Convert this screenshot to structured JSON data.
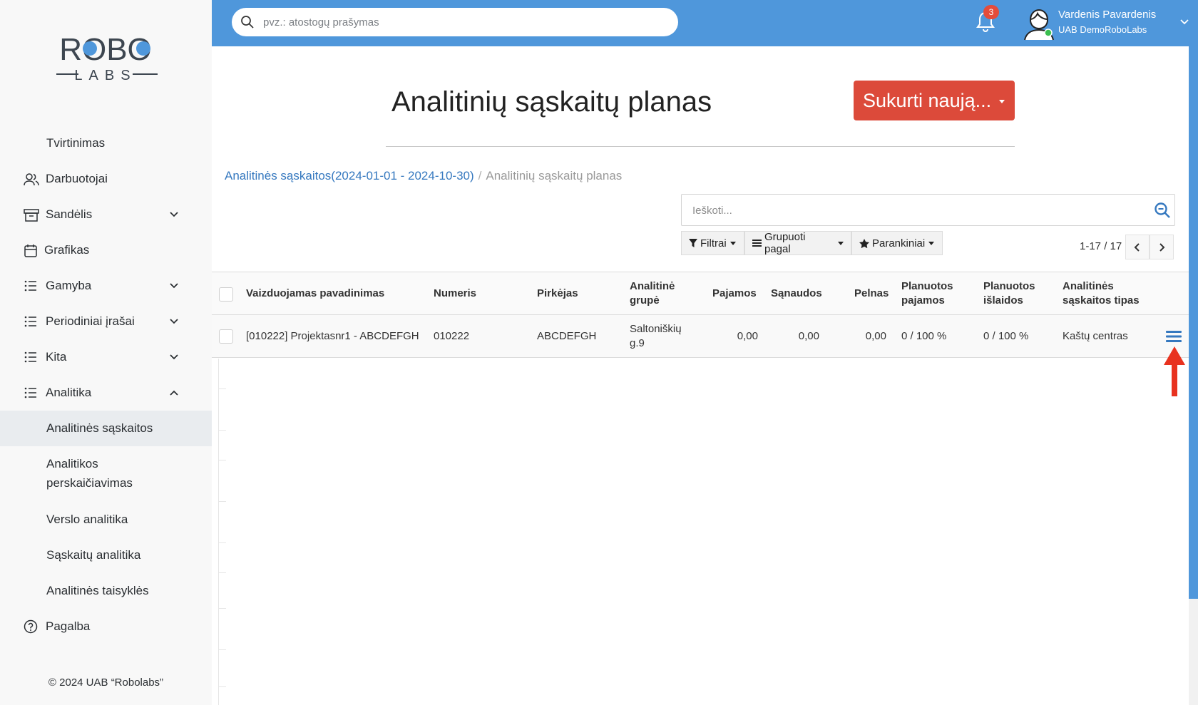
{
  "brand": {
    "logo_top": "ROBO",
    "logo_bottom": "LABS"
  },
  "sidebar": {
    "items": [
      {
        "label": "Tvirtinimas",
        "type": "sub"
      },
      {
        "label": "Darbuotojai",
        "icon": "users-icon"
      },
      {
        "label": "Sandėlis",
        "icon": "archive-icon",
        "expandable": true
      },
      {
        "label": "Grafikas",
        "icon": "calendar-icon"
      },
      {
        "label": "Gamyba",
        "icon": "list-icon",
        "expandable": true
      },
      {
        "label": "Periodiniai įrašai",
        "icon": "list-icon",
        "expandable": true
      },
      {
        "label": "Kita",
        "icon": "list-icon",
        "expandable": true
      },
      {
        "label": "Analitika",
        "icon": "list-icon",
        "expanded": true
      },
      {
        "label": "Analitinės sąskaitos",
        "type": "sub",
        "active": true
      },
      {
        "label": "Analitikos",
        "label2": "perskaičiavimas",
        "type": "sub"
      },
      {
        "label": "Verslo analitika",
        "type": "sub"
      },
      {
        "label": "Sąskaitų analitika",
        "type": "sub"
      },
      {
        "label": "Analitinės taisyklės",
        "type": "sub"
      },
      {
        "label": "Pagalba",
        "icon": "help-icon"
      }
    ],
    "footer": "© 2024 UAB “Robolabs”"
  },
  "topbar": {
    "search_placeholder": "pvz.: atostogų prašymas",
    "notification_count": "3",
    "user_name": "Vardenis Pavardenis",
    "company": "UAB DemoRoboLabs"
  },
  "main": {
    "title": "Analitinių sąskaitų planas",
    "create_button": "Sukurti naują...",
    "breadcrumb": {
      "parent": "Analitinės sąskaitos(2024-01-01 - 2024-10-30)",
      "separator": "/",
      "current": "Analitinių sąskaitų planas"
    },
    "search_placeholder": "Ieškoti...",
    "filters_label": "Filtrai",
    "group_label": "Grupuoti pagal",
    "favorites_label": "Parankiniai",
    "pager": "1-17 / 17"
  },
  "table": {
    "headers": [
      {
        "l1": "Vaizduojamas pavadinimas",
        "l2": ""
      },
      {
        "l1": "Numeris",
        "l2": ""
      },
      {
        "l1": "Pirkėjas",
        "l2": ""
      },
      {
        "l1": "Analitinė",
        "l2": "grupė"
      },
      {
        "l1": "Pajamos",
        "l2": ""
      },
      {
        "l1": "Sąnaudos",
        "l2": ""
      },
      {
        "l1": "Pelnas",
        "l2": ""
      },
      {
        "l1": "Planuotos",
        "l2": "pajamos"
      },
      {
        "l1": "Planuotos",
        "l2": "išlaidos"
      },
      {
        "l1": "Analitinės",
        "l2": "sąskaitos tipas"
      }
    ],
    "rows": [
      {
        "name": "[010222] Projektasnr1 - ABCDEFGH",
        "number": "010222",
        "buyer": "ABCDEFGH",
        "group_l1": "Saltoniškių",
        "group_l2": "g.9",
        "income": "0,00",
        "expenses": "0,00",
        "profit": "0,00",
        "planned_income": "0 / 100 %",
        "planned_expenses": "0 / 100 %",
        "type": "Kaštų centras"
      }
    ]
  },
  "colors": {
    "topbar": "#4f97db",
    "accent_red": "#dc4a3a",
    "link": "#3578bf",
    "active_bg": "#e9ecef"
  }
}
